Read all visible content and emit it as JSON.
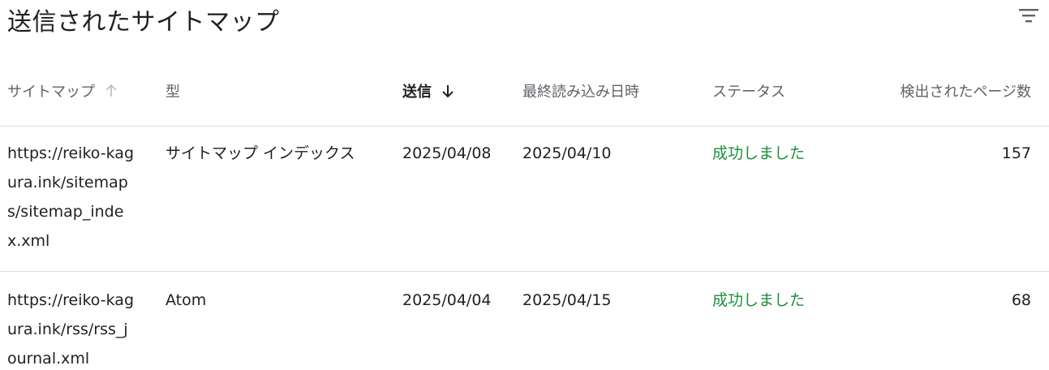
{
  "title": "送信されたサイトマップ",
  "filter_icon": "filter-icon",
  "columns": {
    "sitemap": "サイトマップ",
    "type": "型",
    "submitted": "送信",
    "last_read": "最終読み込み日時",
    "status": "ステータス",
    "discovered_pages": "検出されたページ数"
  },
  "sort": {
    "sitemap_icon": "arrow-up-icon",
    "submitted_icon": "arrow-down-icon"
  },
  "colors": {
    "success": "#1e8e3e",
    "header_text": "#5f6368",
    "divider": "#dadce0"
  },
  "rows": [
    {
      "sitemap": "https://reiko-kagura.ink/sitemaps/sitemap_index.xml",
      "type": "サイトマップ インデックス",
      "submitted": "2025/04/08",
      "last_read": "2025/04/10",
      "status": "成功しました",
      "discovered_pages": "157"
    },
    {
      "sitemap": "https://reiko-kagura.ink/rss/rss_journal.xml",
      "type": "Atom",
      "submitted": "2025/04/04",
      "last_read": "2025/04/15",
      "status": "成功しました",
      "discovered_pages": "68"
    }
  ]
}
